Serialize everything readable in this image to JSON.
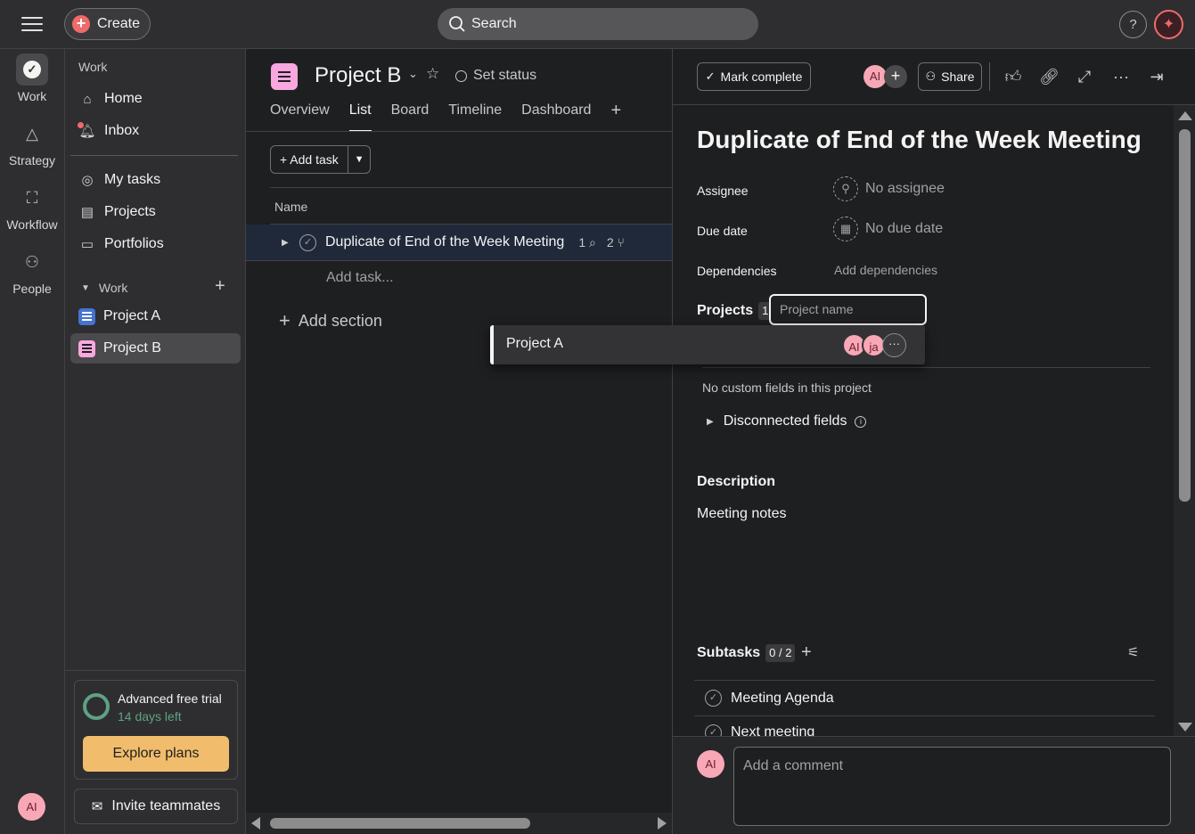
{
  "topbar": {
    "create_label": "Create",
    "search_placeholder": "Search",
    "help_label": "?"
  },
  "rail": {
    "items": [
      {
        "label": "Work",
        "icon": "check-circle-icon"
      },
      {
        "label": "Strategy",
        "icon": "triangle-icon"
      },
      {
        "label": "Workflow",
        "icon": "workflow-icon"
      },
      {
        "label": "People",
        "icon": "people-icon"
      }
    ],
    "avatar_initials": "AI"
  },
  "sidebar": {
    "top_heading": "Work",
    "nav": [
      {
        "label": "Home",
        "icon": "home-icon"
      },
      {
        "label": "Inbox",
        "icon": "bell-icon"
      }
    ],
    "my_items": [
      {
        "label": "My tasks",
        "icon": "check-circle-icon"
      },
      {
        "label": "Projects",
        "icon": "clipboard-icon"
      },
      {
        "label": "Portfolios",
        "icon": "folder-icon"
      }
    ],
    "work_section": "Work",
    "projects": [
      {
        "label": "Project A",
        "color": "#4573d2"
      },
      {
        "label": "Project B",
        "color": "#f8a7df"
      }
    ],
    "trial": {
      "title": "Advanced free trial",
      "days_left": "14 days left",
      "explore_label": "Explore plans"
    },
    "invite_label": "Invite teammates"
  },
  "main": {
    "project_title": "Project B",
    "set_status": "Set status",
    "tabs": [
      "Overview",
      "List",
      "Board",
      "Timeline",
      "Dashboard"
    ],
    "active_tab": "List",
    "add_task_label": "Add task",
    "column_name": "Name",
    "tasks": [
      {
        "name": "Duplicate of End of the Week Meeting",
        "attachments": "1",
        "subtasks": "2"
      }
    ],
    "add_task_placeholder": "Add task...",
    "add_section_label": "Add section"
  },
  "detail": {
    "mark_complete_label": "Mark complete",
    "collaborator_initials": "AI",
    "share_label": "Share",
    "title": "Duplicate of End of the Week Meeting",
    "assignee_label": "Assignee",
    "assignee_value": "No assignee",
    "due_label": "Due date",
    "due_value": "No due date",
    "deps_label": "Dependencies",
    "deps_value": "Add dependencies",
    "projects_label": "Projects",
    "projects_count": "1",
    "project_input_placeholder": "Project name",
    "no_custom_fields": "No custom fields in this project",
    "disconnected_label": "Disconnected fields",
    "description_label": "Description",
    "description_text": "Meeting notes",
    "subtasks_label": "Subtasks",
    "subtasks_count": "0 / 2",
    "subtasks": [
      "Meeting Agenda",
      "Next meeting"
    ],
    "comment_avatar": "AI",
    "comment_placeholder": "Add a comment"
  },
  "dropdown": {
    "option_label": "Project A",
    "avatars": [
      "AI",
      "ja"
    ],
    "more_label": "···"
  },
  "colors": {
    "accent": "#f06a6a",
    "trial_green": "#5da283",
    "explore_yellow": "#f1bd6c",
    "avatar_pink": "#f8a7b6"
  }
}
